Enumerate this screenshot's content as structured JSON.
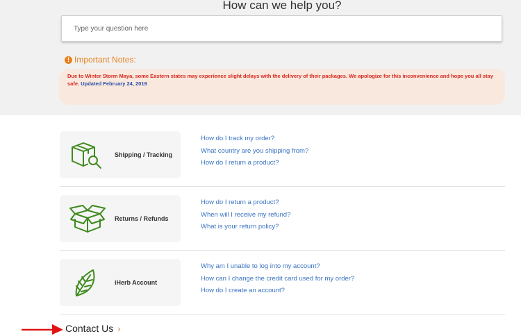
{
  "header": {
    "title": "How can we help you?"
  },
  "search": {
    "placeholder": "Type your question here"
  },
  "notes": {
    "title": "Important Notes:",
    "message": "Due to Winter Storm Maya, some Eastern states may experience slight delays with the delivery of their packages. We apologize for this inconvenience and hope you all stay safe.",
    "updated": "Updated February 24, 2019"
  },
  "categories": [
    {
      "label": "Shipping / Tracking",
      "icon": "box-search-icon",
      "links": [
        "How do I track my order?",
        "What country are you shipping from?",
        "How do I return a product?"
      ]
    },
    {
      "label": "Returns / Refunds",
      "icon": "open-box-icon",
      "links": [
        "How do I return a product?",
        "When will I receive my refund?",
        "What is your return policy?"
      ]
    },
    {
      "label": "iHerb Account",
      "icon": "leaf-icon",
      "links": [
        "Why am I unable to log into my account?",
        "How can I change the credit card used for my order?",
        "How do I create an account?"
      ]
    }
  ],
  "contact": {
    "label": "Contact Us",
    "chevron": "›"
  },
  "colors": {
    "accent": "#e8821e",
    "link": "#3a73c2",
    "icon_green": "#3f8a1e",
    "notice_bg": "#f9e8de",
    "notice_text": "#d7261e",
    "arrow": "#e01414"
  }
}
